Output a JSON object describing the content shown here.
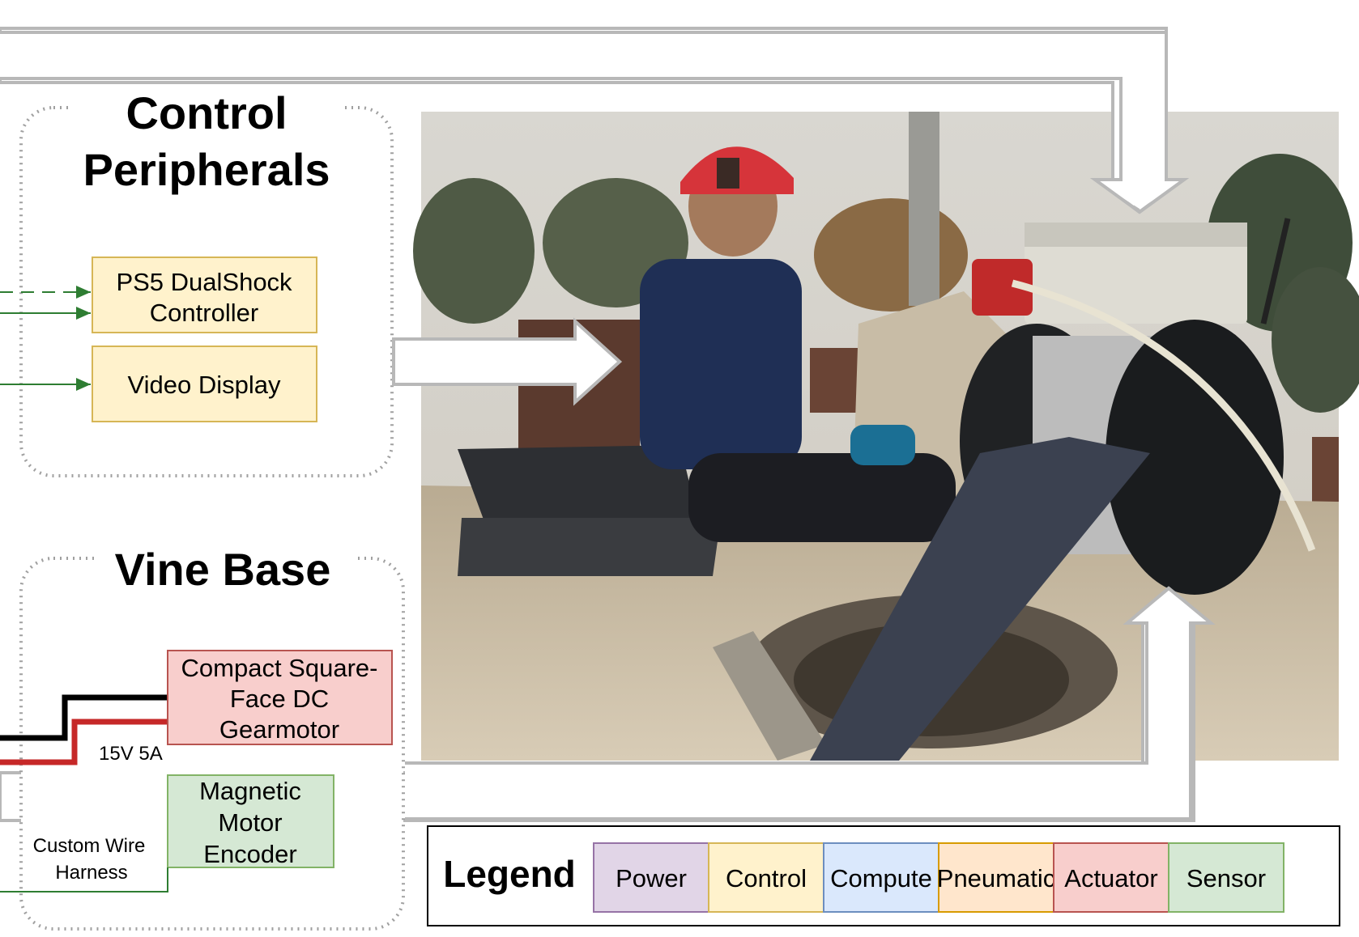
{
  "groups": {
    "control": {
      "title_line1": "Control",
      "title_line2": "Peripherals"
    },
    "vine": {
      "title": "Vine Base"
    }
  },
  "nodes": {
    "ps5": {
      "line1": "PS5 DualShock",
      "line2": "Controller"
    },
    "video": {
      "label": "Video Display"
    },
    "motor": {
      "line1": "Compact Square-",
      "line2": "Face DC",
      "line3": "Gearmotor"
    },
    "encoder": {
      "line1": "Magnetic",
      "line2": "Motor",
      "line3": "Encoder"
    }
  },
  "edge_labels": {
    "power": "15V 5A",
    "harness_line1": "Custom Wire",
    "harness_line2": "Harness"
  },
  "photo": {
    "description_icon": "field-deployment-photo"
  },
  "legend": {
    "title": "Legend",
    "items": [
      {
        "label": "Power",
        "fill": "#e1d5e7",
        "stroke": "#9673a6"
      },
      {
        "label": "Control",
        "fill": "#fff2cc",
        "stroke": "#d6b656"
      },
      {
        "label": "Compute",
        "fill": "#dae8fc",
        "stroke": "#6c8ebf"
      },
      {
        "label": "Pneumatic",
        "fill": "#ffe6cc",
        "stroke": "#d79b00"
      },
      {
        "label": "Actuator",
        "fill": "#f8cecc",
        "stroke": "#b85450"
      },
      {
        "label": "Sensor",
        "fill": "#d5e8d4",
        "stroke": "#82b366"
      }
    ]
  },
  "colors": {
    "control_fill": "#fff2cc",
    "control_stroke": "#d6b656",
    "actuator_fill": "#f8cecc",
    "actuator_stroke": "#b85450",
    "sensor_fill": "#d5e8d4",
    "sensor_stroke": "#82b366",
    "signal_line": "#2e7d32",
    "power_red": "#c62828",
    "power_black": "#000000",
    "arrow_gray": "#b8b8b8",
    "group_border": "#a0a0a0"
  }
}
